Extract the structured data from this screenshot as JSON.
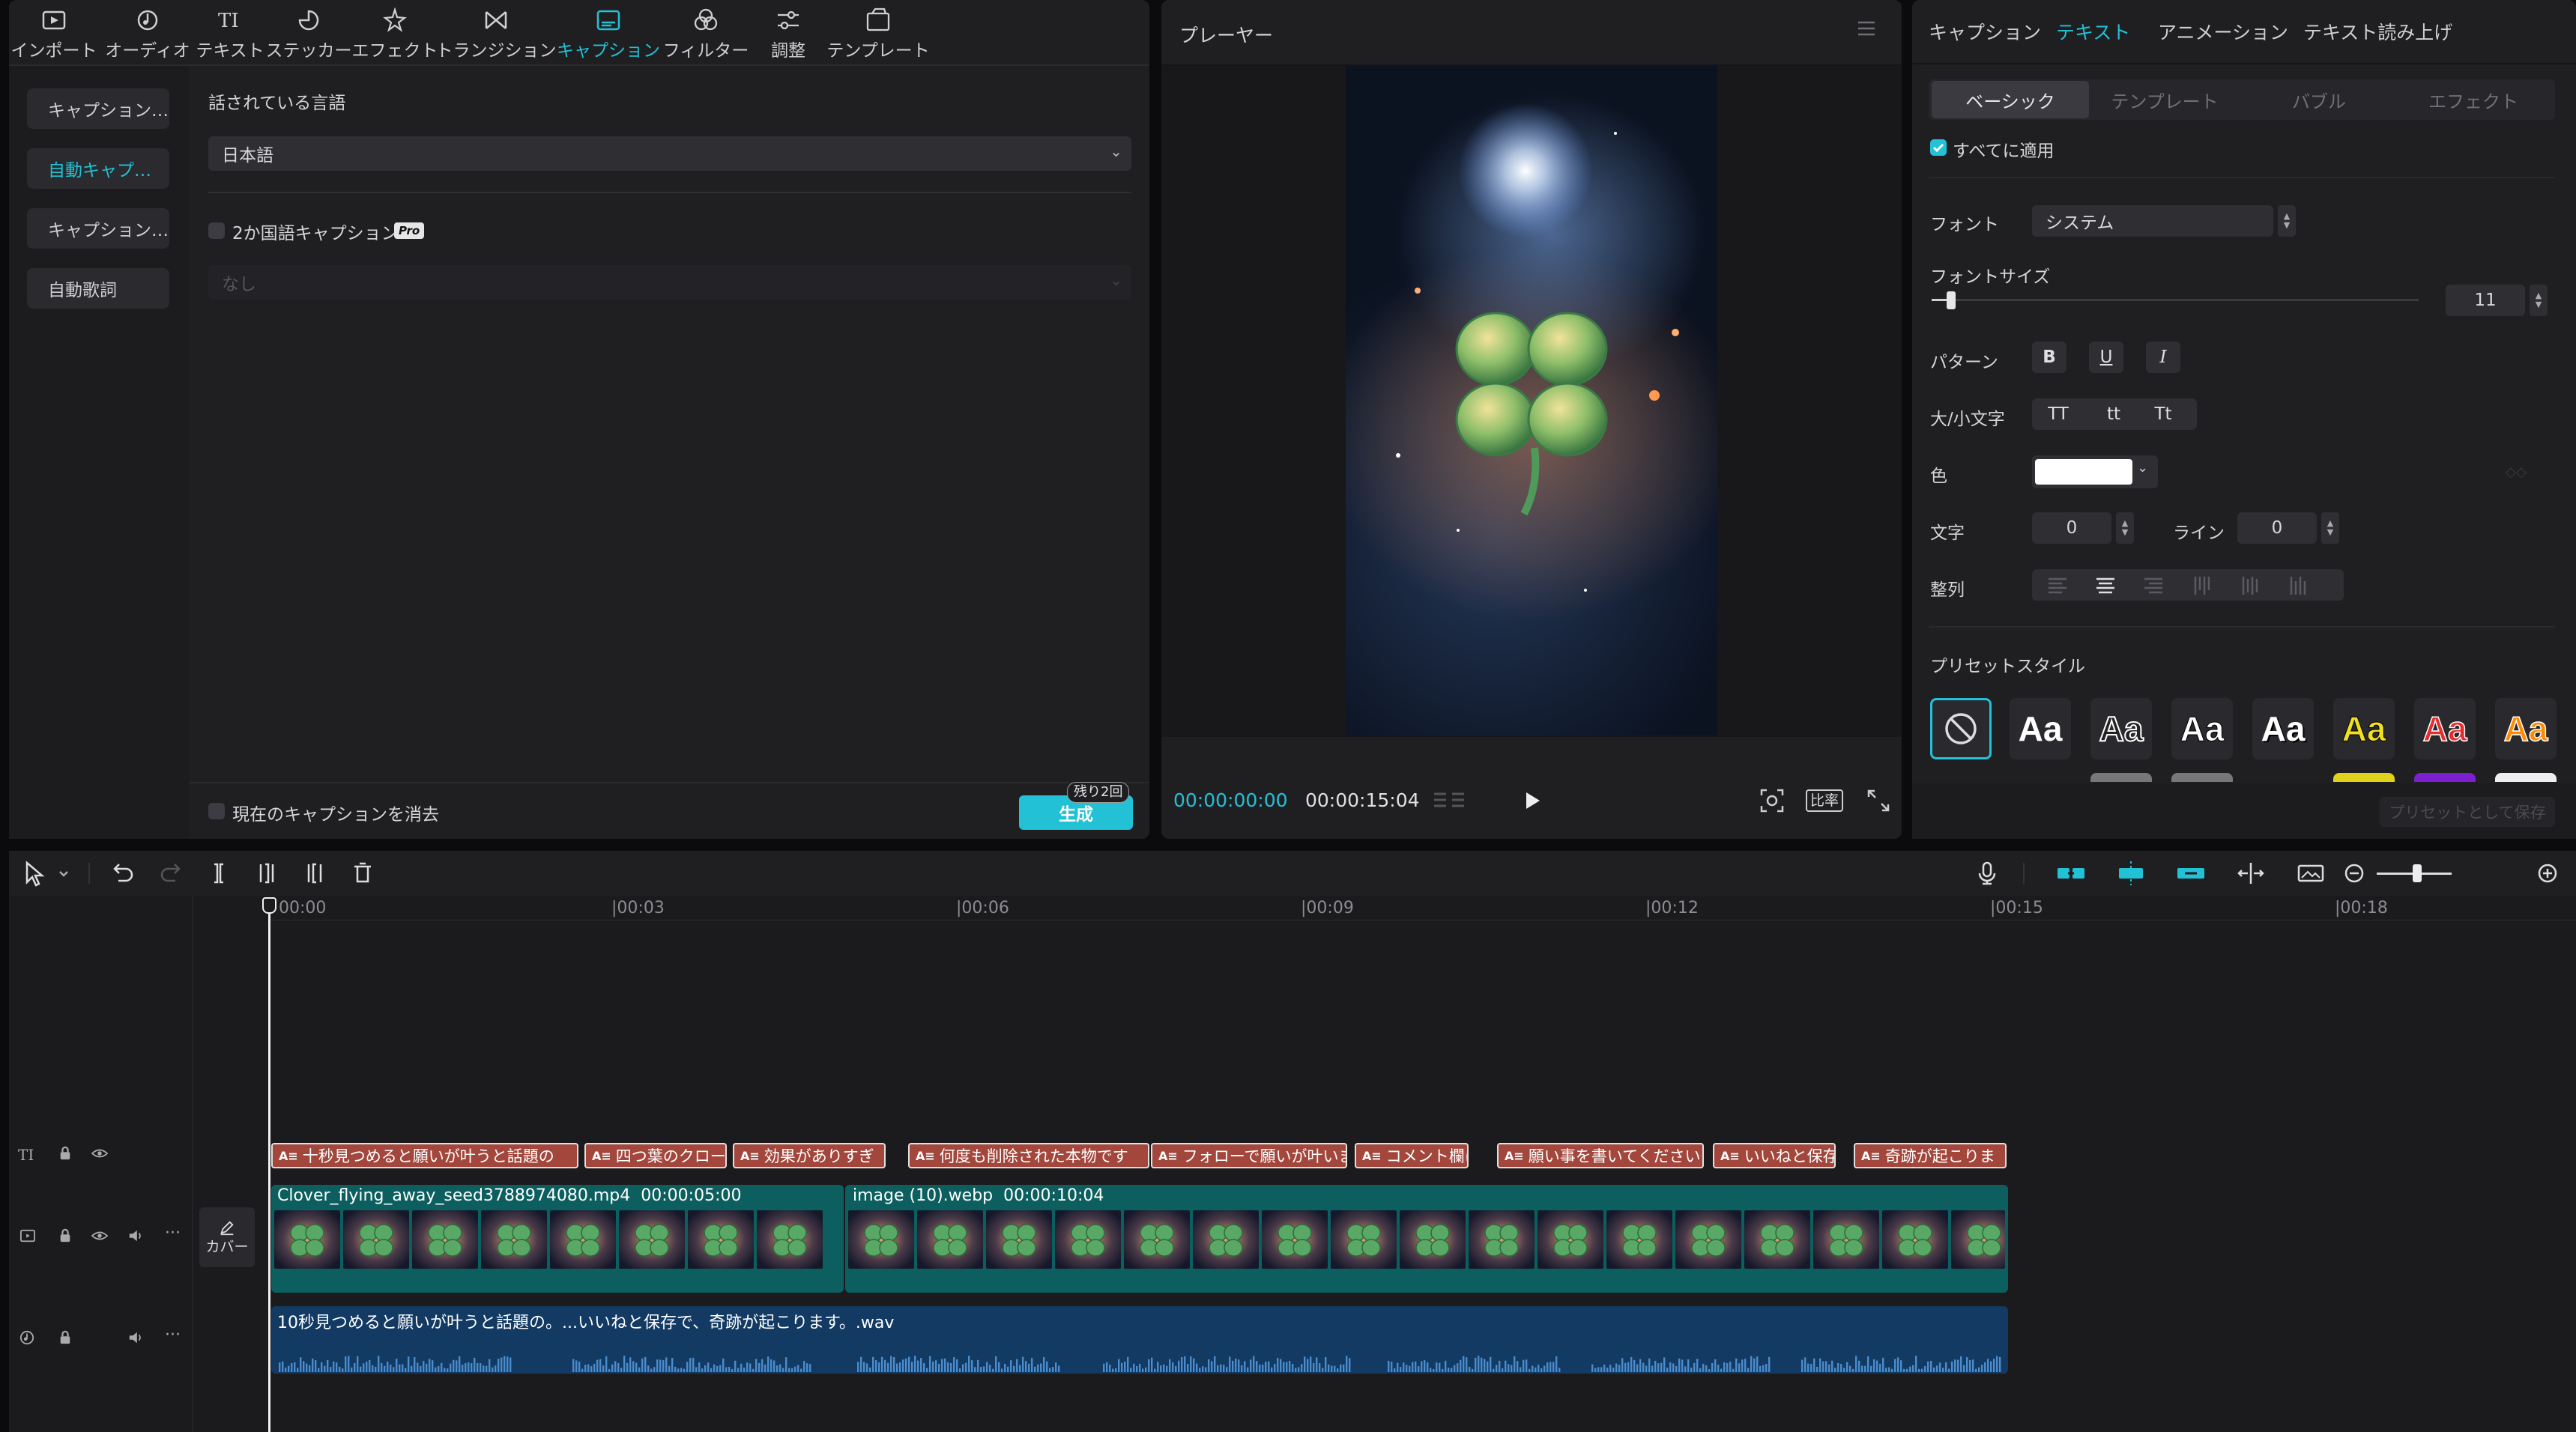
{
  "toolbar": {
    "items": [
      {
        "label": "インポート",
        "icon": "import-icon"
      },
      {
        "label": "オーディオ",
        "icon": "audio-icon"
      },
      {
        "label": "テキスト",
        "icon": "text-icon"
      },
      {
        "label": "ステッカー",
        "icon": "sticker-icon"
      },
      {
        "label": "エフェクト",
        "icon": "effect-icon"
      },
      {
        "label": "トランジション",
        "icon": "transition-icon"
      },
      {
        "label": "キャプション",
        "icon": "caption-icon",
        "active": true
      },
      {
        "label": "フィルター",
        "icon": "filter-icon"
      },
      {
        "label": "調整",
        "icon": "adjust-icon"
      },
      {
        "label": "テンプレート",
        "icon": "template-icon"
      }
    ]
  },
  "caption_menu": {
    "items": [
      "キャプション…",
      "自動キャプ…",
      "キャプション…",
      "自動歌詞"
    ],
    "active_index": 1
  },
  "auto_caption": {
    "language_label": "話されている言語",
    "language_value": "日本語",
    "bilingual_label": "2か国語キャプション",
    "pro_badge": "Pro",
    "second_language_placeholder": "なし",
    "clear_label": "現在のキャプションを消去",
    "remaining_badge": "残り2回",
    "generate_label": "生成"
  },
  "player": {
    "title": "プレーヤー",
    "current_time": "00:00:00:00",
    "total_time": "00:00:15:04",
    "ratio_label": "比率"
  },
  "inspector": {
    "tabs": [
      "キャプション",
      "テキスト",
      "アニメーション",
      "テキスト読み上げ"
    ],
    "active_tab": 1,
    "subtabs": [
      "ベーシック",
      "テンプレート",
      "バブル",
      "エフェクト"
    ],
    "active_subtab": 0,
    "apply_all": "すべてに適用",
    "font_label": "フォント",
    "font_value": "システム",
    "font_size_label": "フォントサイズ",
    "font_size_value": "11",
    "font_size_level": 0.04,
    "pattern_label": "パターン",
    "pattern_buttons": [
      "B",
      "U",
      "I"
    ],
    "case_label": "大/小文字",
    "case_buttons": [
      "TT",
      "tt",
      "Tt"
    ],
    "color_label": "色",
    "color_value": "#ffffff",
    "char_label": "文字",
    "char_value": "0",
    "line_label": "ライン",
    "line_value": "0",
    "align_label": "整列",
    "preset_label": "プリセットスタイル",
    "preset_text": "Aa",
    "save_preset": "プリセットとして保存"
  },
  "timeline": {
    "ticks": [
      "00:00",
      "|00:03",
      "|00:06",
      "|00:09",
      "|00:12",
      "|00:15",
      "|00:18"
    ],
    "cover_label": "カバー",
    "captions": [
      "十秒見つめると願いが叶うと話題の",
      "四つ葉のクロー",
      "効果がありすぎ",
      "何度も削除された本物です",
      "フォローで願いが叶いま",
      "コメント欄に",
      "願い事を書いてください",
      "いいねと保存で",
      "奇跡が起こりま"
    ],
    "video_clips": [
      {
        "name": "Clover_flying_away_seed3788974080.mp4",
        "duration": "00:00:05:00"
      },
      {
        "name": "image (10).webp",
        "duration": "00:00:10:04"
      }
    ],
    "audio_clip": "10秒見つめると願いが叶うと話題の。...いいねと保存で、奇跡が起こります。.wav"
  },
  "colors": {
    "accent": "#22c1d6",
    "caption_clip": "#a3473d",
    "video_clip": "#0d5f5f",
    "audio_clip": "#123a63"
  }
}
